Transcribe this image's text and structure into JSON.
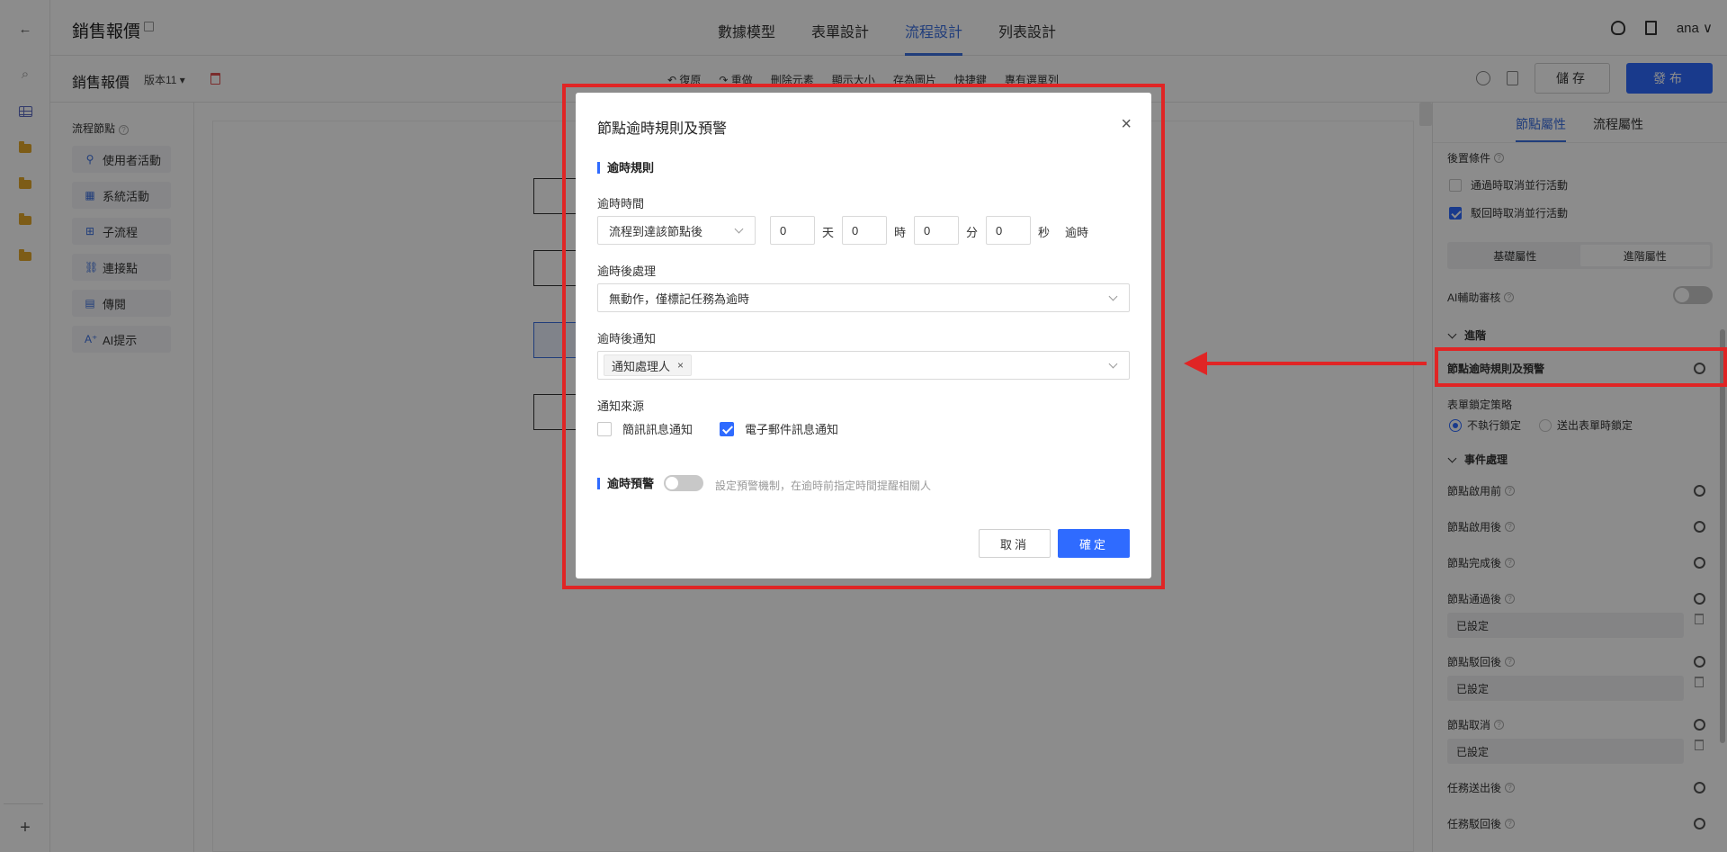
{
  "header": {
    "app_title": "銷售報價",
    "tabs": [
      "數據模型",
      "表單設計",
      "流程設計",
      "列表設計"
    ],
    "active_tab": "流程設計",
    "user": "ana ∨"
  },
  "toolbar": {
    "doc_title": "銷售報價",
    "version": "版本11 ▾",
    "tools": [
      "↶ 復原",
      "↷ 重做",
      "刪除元素",
      "顯示大小",
      "存為圖片",
      "快捷鍵",
      "專有選單列"
    ],
    "save_label": "儲存",
    "publish_label": "發布"
  },
  "node_panel": {
    "title": "流程節點",
    "items": [
      {
        "icon": "user-icon",
        "glyph": "⚲",
        "label": "使用者活動"
      },
      {
        "icon": "grid-icon",
        "glyph": "▦",
        "label": "系統活動"
      },
      {
        "icon": "subflow-icon",
        "glyph": "⊞",
        "label": "子流程"
      },
      {
        "icon": "link-icon",
        "glyph": "⛓",
        "label": "連接點"
      },
      {
        "icon": "relay-icon",
        "glyph": "▤",
        "label": "傳閱"
      },
      {
        "icon": "ai-icon",
        "glyph": "A⁺",
        "label": "AI提示"
      }
    ]
  },
  "properties": {
    "tabs": [
      "節點屬性",
      "流程屬性"
    ],
    "active_tab": "節點屬性",
    "post_condition": "後置條件",
    "cb_pass_cancel": "通過時取消並行活動",
    "cb_reject_cancel": "駁回時取消並行活動",
    "seg_basic": "基礎屬性",
    "seg_advanced": "進階屬性",
    "ai_review": "AI輔助審核",
    "advanced": "進階",
    "timeout_rule": "節點逾時規則及預警",
    "lock_strategy": "表單鎖定策略",
    "radio_no_lock": "不執行鎖定",
    "radio_lock_on_submit": "送出表單時鎖定",
    "event_handling": "事件處理",
    "events": {
      "before_enable": "節點啟用前",
      "after_enable": "節點啟用後",
      "after_complete": "節點完成後",
      "after_pass": "節點通過後",
      "after_reject": "節點駁回後",
      "cancel": "節點取消",
      "after_task_submit": "任務送出後",
      "after_task_reject": "任務駁回後"
    },
    "set_value": "已設定"
  },
  "modal": {
    "title": "節點逾時規則及預警",
    "close": "×",
    "section_rule": "逾時規則",
    "timeout_time_label": "逾時時間",
    "timeout_basis": "流程到達該節點後",
    "days": "0",
    "hours": "0",
    "minutes": "0",
    "seconds": "0",
    "unit_day": "天",
    "unit_hour": "時",
    "unit_min": "分",
    "unit_sec": "秒",
    "suffix": "逾時",
    "after_action_label": "逾時後處理",
    "after_action_value": "無動作，僅標記任務為逾時",
    "notify_label": "逾時後通知",
    "notify_tag": "通知處理人",
    "notify_tag_remove": "×",
    "source_label": "通知來源",
    "source_sms": "簡訊訊息通知",
    "source_email": "電子郵件訊息通知",
    "source_sms_checked": false,
    "source_email_checked": true,
    "section_warning": "逾時預警",
    "warning_hint": "設定預警機制，在逾時前指定時間提醒相關人",
    "cancel_label": "取消",
    "ok_label": "確定"
  },
  "colors": {
    "accent": "#2f6bff",
    "highlight": "#e02525"
  }
}
